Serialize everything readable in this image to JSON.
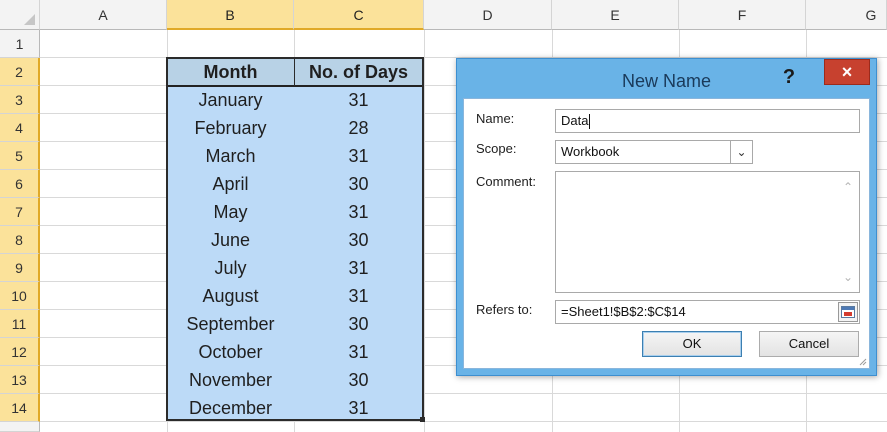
{
  "columns": [
    "A",
    "B",
    "C",
    "D",
    "E",
    "F",
    "G"
  ],
  "rows": [
    "1",
    "2",
    "3",
    "4",
    "5",
    "6",
    "7",
    "8",
    "9",
    "10",
    "11",
    "12",
    "13",
    "14"
  ],
  "table": {
    "headers": [
      "Month",
      "No. of Days"
    ],
    "rows": [
      [
        "January",
        "31"
      ],
      [
        "February",
        "28"
      ],
      [
        "March",
        "31"
      ],
      [
        "April",
        "30"
      ],
      [
        "May",
        "31"
      ],
      [
        "June",
        "30"
      ],
      [
        "July",
        "31"
      ],
      [
        "August",
        "31"
      ],
      [
        "September",
        "30"
      ],
      [
        "October",
        "31"
      ],
      [
        "November",
        "30"
      ],
      [
        "December",
        "31"
      ]
    ]
  },
  "dialog": {
    "title": "New Name",
    "help_label": "?",
    "close_label": "×",
    "name_label": "Name:",
    "name_value": "Data",
    "scope_label": "Scope:",
    "scope_value": "Workbook",
    "comment_label": "Comment:",
    "comment_value": "",
    "refers_label": "Refers to:",
    "refers_value": "=Sheet1!$B$2:$C$14",
    "ok_label": "OK",
    "cancel_label": "Cancel"
  },
  "colors": {
    "selection_fill": "#bcdaf7",
    "header_highlight": "#fbe29a",
    "dialog_frame": "#69b3e7",
    "close_button": "#c7412f"
  }
}
